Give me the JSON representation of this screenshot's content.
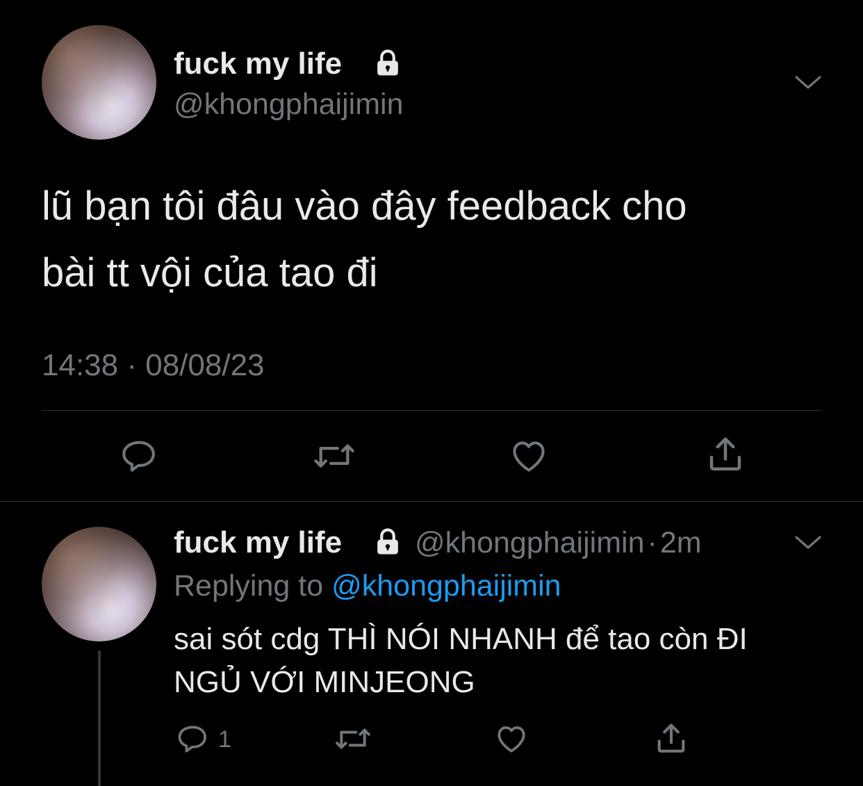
{
  "main_tweet": {
    "display_name": "fuck my life",
    "handle": "@khongphaijimin",
    "text_line1": "lũ bạn tôi đâu vào đây feedback cho",
    "text_line2": "bài tt vội của tao đi",
    "time": "14:38",
    "separator": "·",
    "date": "08/08/23"
  },
  "reply_tweet": {
    "display_name": "fuck my life",
    "handle": "@khongphaijimin",
    "dot": "·",
    "age": "2m",
    "replying_prefix": "Replying to",
    "replying_handle": "@khongphaijimin",
    "text_line1": "sai sót cdg THÌ NÓI NHANH để tao còn ĐI",
    "text_line2": "NGỦ VỚI MINJEONG",
    "reply_count": "1"
  },
  "icons": {
    "lock": "lock-icon",
    "chevron": "chevron-down-icon",
    "reply": "reply-icon",
    "retweet": "retweet-icon",
    "like": "heart-icon",
    "share": "share-icon"
  },
  "colors": {
    "background": "#000000",
    "text": "#e7e9ea",
    "muted": "#71767b",
    "accent": "#1d9bf0",
    "divider": "#2f3336"
  }
}
